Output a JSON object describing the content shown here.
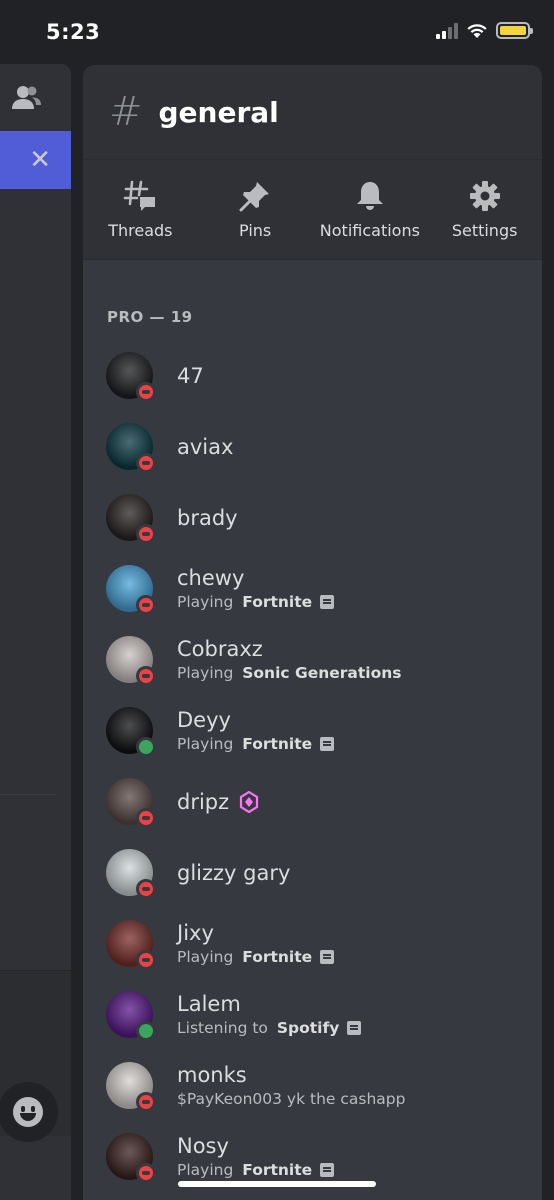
{
  "status_bar": {
    "time": "5:23",
    "signal_icon": "cellular-signal-icon",
    "wifi_icon": "wifi-icon",
    "battery_icon": "battery-icon",
    "battery_color": "#f5d33d"
  },
  "left_panel": {
    "members_icon": "members-icon",
    "close_label": "✕",
    "emoji_icon": "emoji-icon"
  },
  "channel": {
    "hash": "#",
    "name": "general"
  },
  "actions": [
    {
      "label": "Threads",
      "icon": "threads-icon"
    },
    {
      "label": "Pins",
      "icon": "pin-icon"
    },
    {
      "label": "Notifications",
      "icon": "bell-icon"
    },
    {
      "label": "Settings",
      "icon": "gear-icon"
    }
  ],
  "section": {
    "title": "PRO — 19"
  },
  "members": [
    {
      "name": "47",
      "status": "dnd",
      "avatar_color": "#1e1f22"
    },
    {
      "name": "aviax",
      "status": "dnd",
      "avatar_color": "#0b3b45"
    },
    {
      "name": "brady",
      "status": "dnd",
      "avatar_color": "#2b2424"
    },
    {
      "name": "chewy",
      "status": "dnd",
      "avatar_color": "#4aa3d8",
      "activity_prefix": "Playing ",
      "activity": "Fortnite",
      "rich_presence": true
    },
    {
      "name": "Cobraxz",
      "status": "dnd",
      "avatar_color": "#c9c2c0",
      "activity_prefix": "Playing ",
      "activity": "Sonic Generations"
    },
    {
      "name": "Deyy",
      "status": "online",
      "avatar_color": "#111214",
      "activity_prefix": "Playing ",
      "activity": "Fortnite",
      "rich_presence": true
    },
    {
      "name": "dripz",
      "status": "dnd",
      "avatar_color": "#5a4a48",
      "boost": true
    },
    {
      "name": "glizzy gary",
      "status": "dnd",
      "avatar_color": "#cfd6d8"
    },
    {
      "name": "Jixy",
      "status": "dnd",
      "avatar_color": "#7a2f2a",
      "activity_prefix": "Playing ",
      "activity": "Fortnite",
      "rich_presence": true
    },
    {
      "name": "Lalem",
      "status": "online",
      "avatar_color": "#5a1a8a",
      "activity_prefix": "Listening to ",
      "activity": "Spotify",
      "rich_presence": true
    },
    {
      "name": "monks",
      "status": "dnd",
      "avatar_color": "#d6d2cf",
      "custom_status": "$PayKeon003 yk the cashapp"
    },
    {
      "name": "Nosy",
      "status": "dnd",
      "avatar_color": "#3a2220",
      "activity_prefix": "Playing ",
      "activity": "Fortnite",
      "rich_presence": true
    }
  ]
}
